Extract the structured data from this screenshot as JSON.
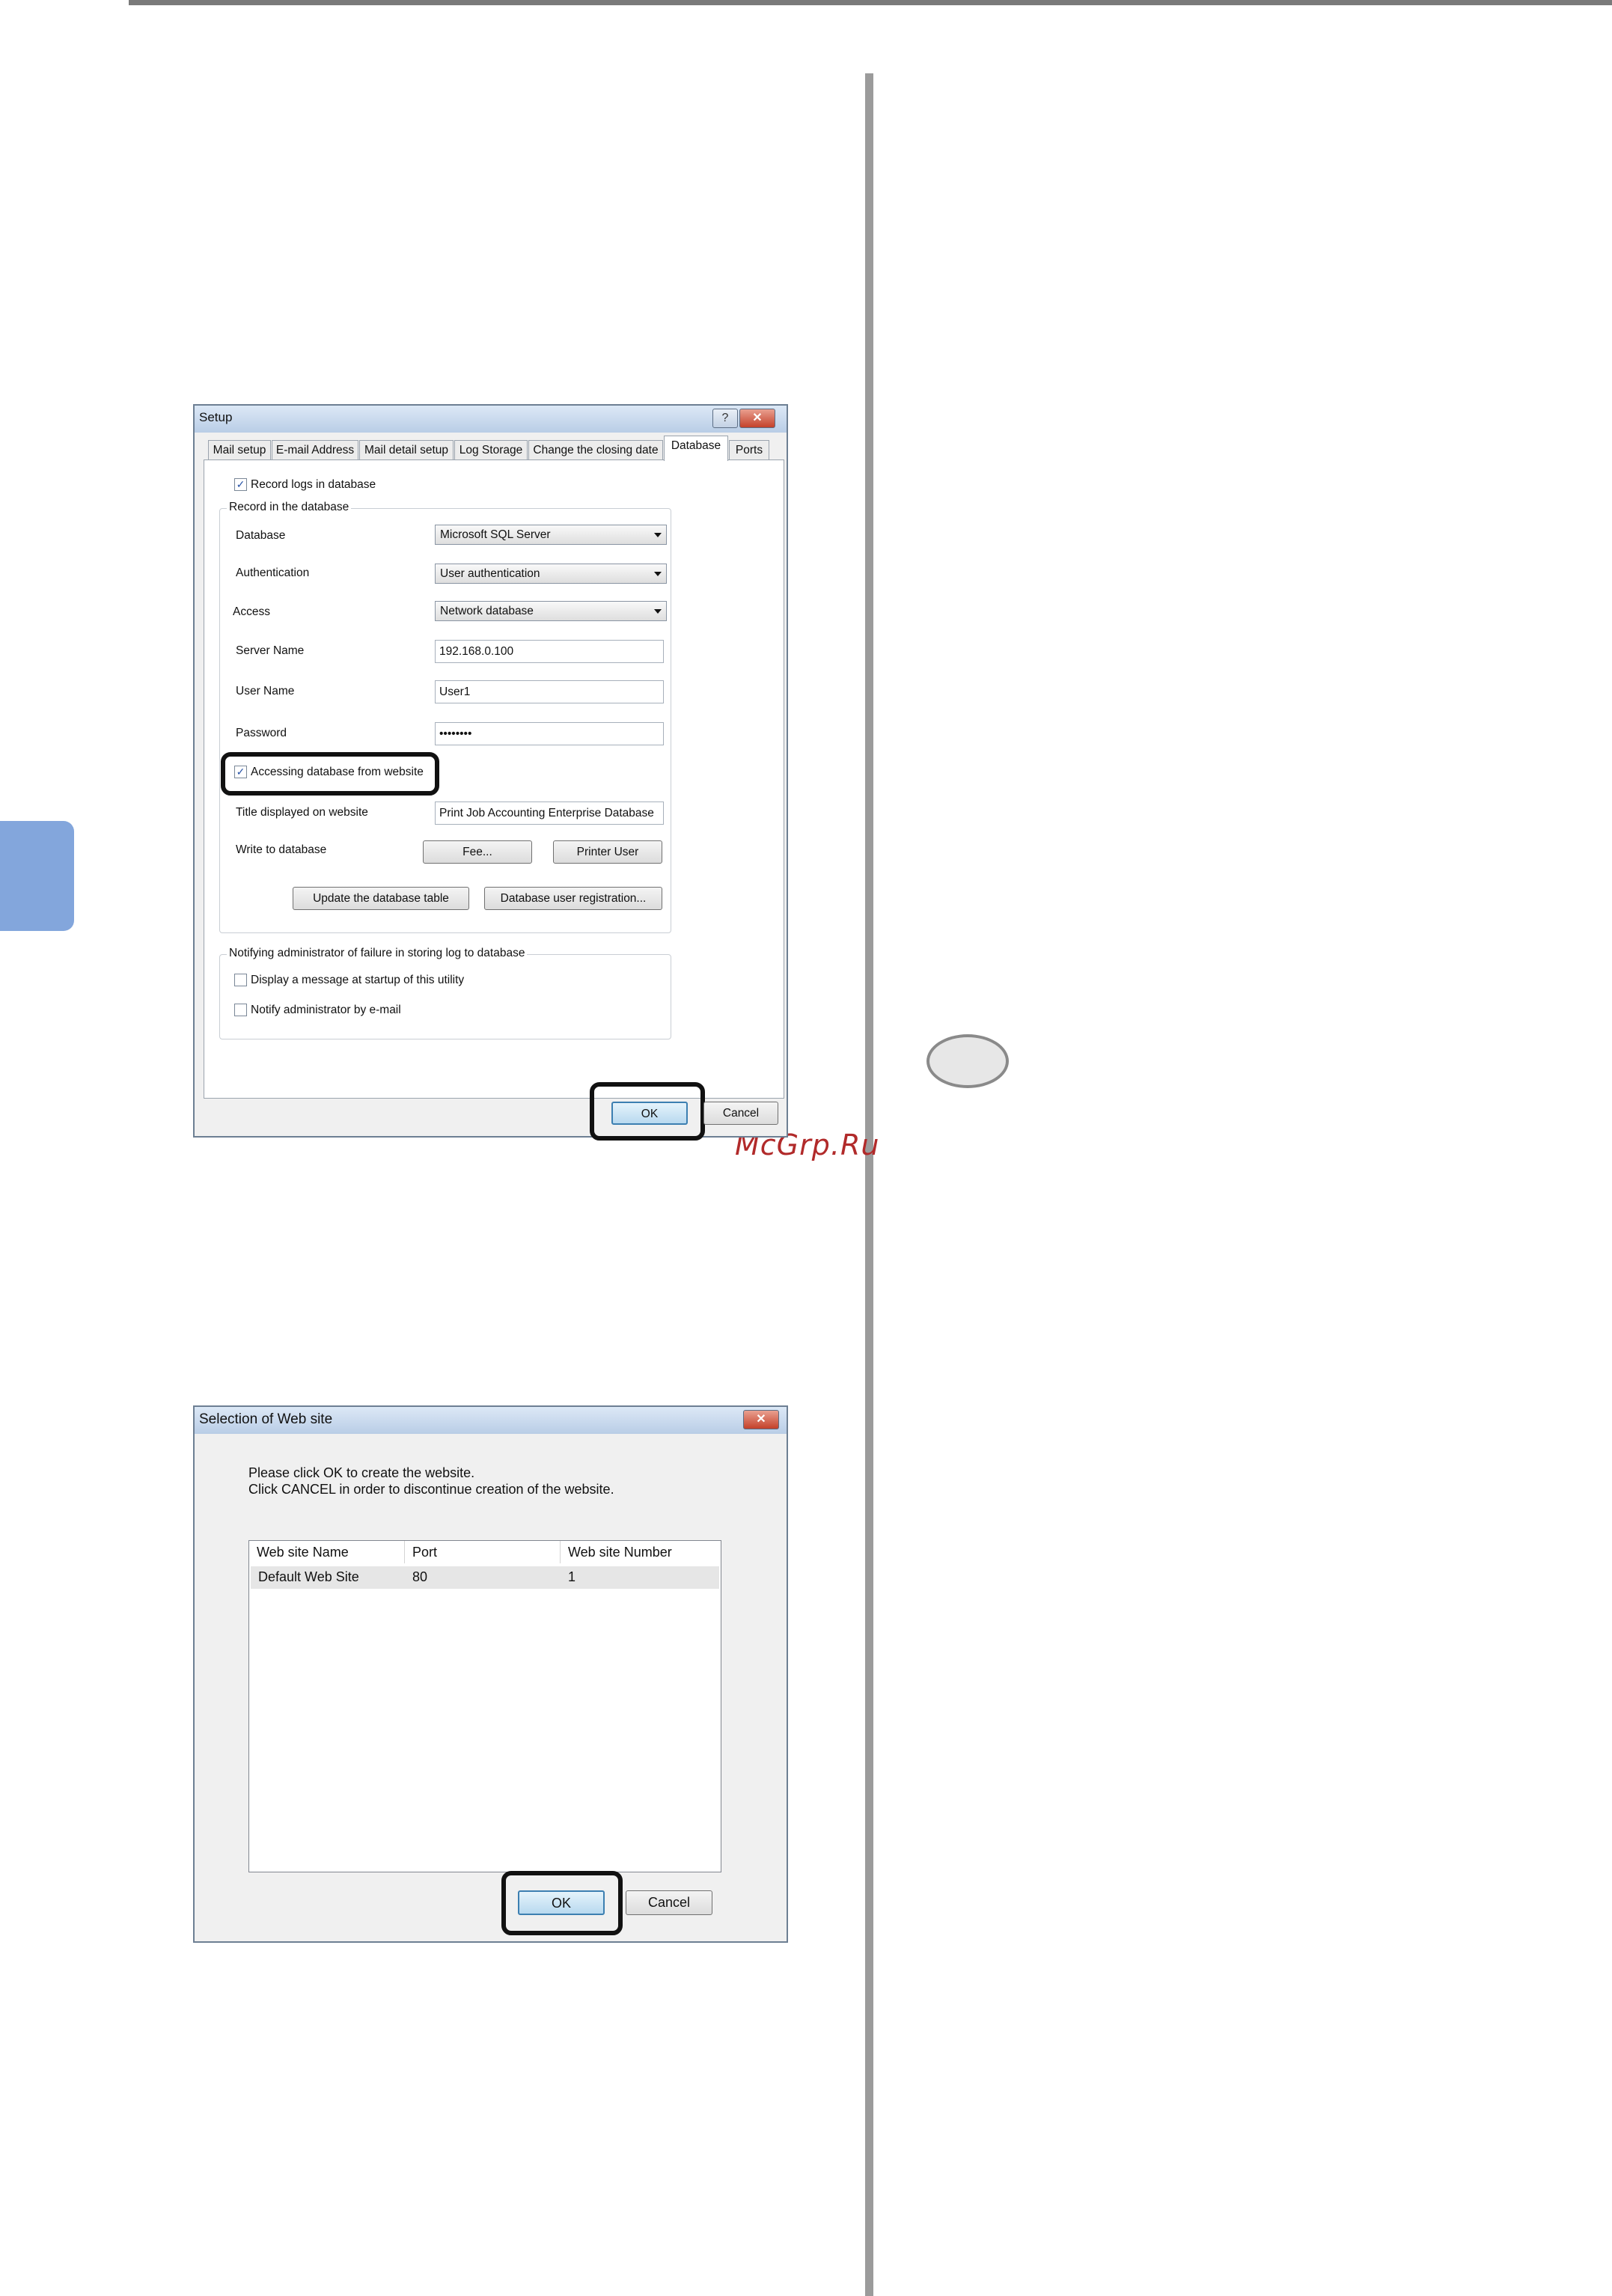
{
  "setup_dialog": {
    "title": "Setup",
    "help_button": "?",
    "close_button": "✕",
    "tabs": [
      "Mail setup",
      "E-mail Address",
      "Mail detail setup",
      "Log Storage",
      "Change the closing date",
      "Database",
      "Ports"
    ],
    "active_tab": "Database",
    "record_logs": {
      "label": "Record logs in database",
      "checked": true
    },
    "record_group": {
      "label": "Record in the database",
      "database": {
        "label": "Database",
        "value": "Microsoft SQL Server"
      },
      "authentication": {
        "label": "Authentication",
        "value": "User authentication"
      },
      "access": {
        "label": "Access",
        "value": "Network database"
      },
      "server_name": {
        "label": "Server Name",
        "value": "192.168.0.100"
      },
      "user_name": {
        "label": "User Name",
        "value": "User1"
      },
      "password": {
        "label": "Password",
        "value": "••••••••"
      },
      "accessing_website": {
        "label": "Accessing database from website",
        "checked": true
      },
      "title_on_website": {
        "label": "Title displayed on website",
        "value": "Print Job Accounting Enterprise Database"
      },
      "write_to_database": {
        "label": "Write to database",
        "fee_button": "Fee...",
        "printer_user_button": "Printer User"
      },
      "update_table_button": "Update the database table",
      "user_registration_button": "Database user registration..."
    },
    "notify_group": {
      "label": "Notifying administrator of failure in storing log to database",
      "display_message": {
        "label": "Display a message at startup of this utility",
        "checked": false
      },
      "notify_email": {
        "label": "Notify administrator by e-mail",
        "checked": false
      }
    },
    "ok_button": "OK",
    "cancel_button": "Cancel"
  },
  "website_dialog": {
    "title": "Selection of Web site",
    "close_button": "✕",
    "message_line1": "Please click OK to create the website.",
    "message_line2": "Click CANCEL in order to discontinue creation of the website.",
    "columns": [
      "Web site Name",
      "Port",
      "Web site Number"
    ],
    "rows": [
      [
        "Default Web Site",
        "80",
        "1"
      ]
    ],
    "ok_button": "OK",
    "cancel_button": "Cancel"
  },
  "watermark": "McGrp.Ru",
  "colors": {
    "side_tab": "#83a6dc",
    "highlight_frame": "#111111",
    "watermark": "#b12a2a"
  }
}
